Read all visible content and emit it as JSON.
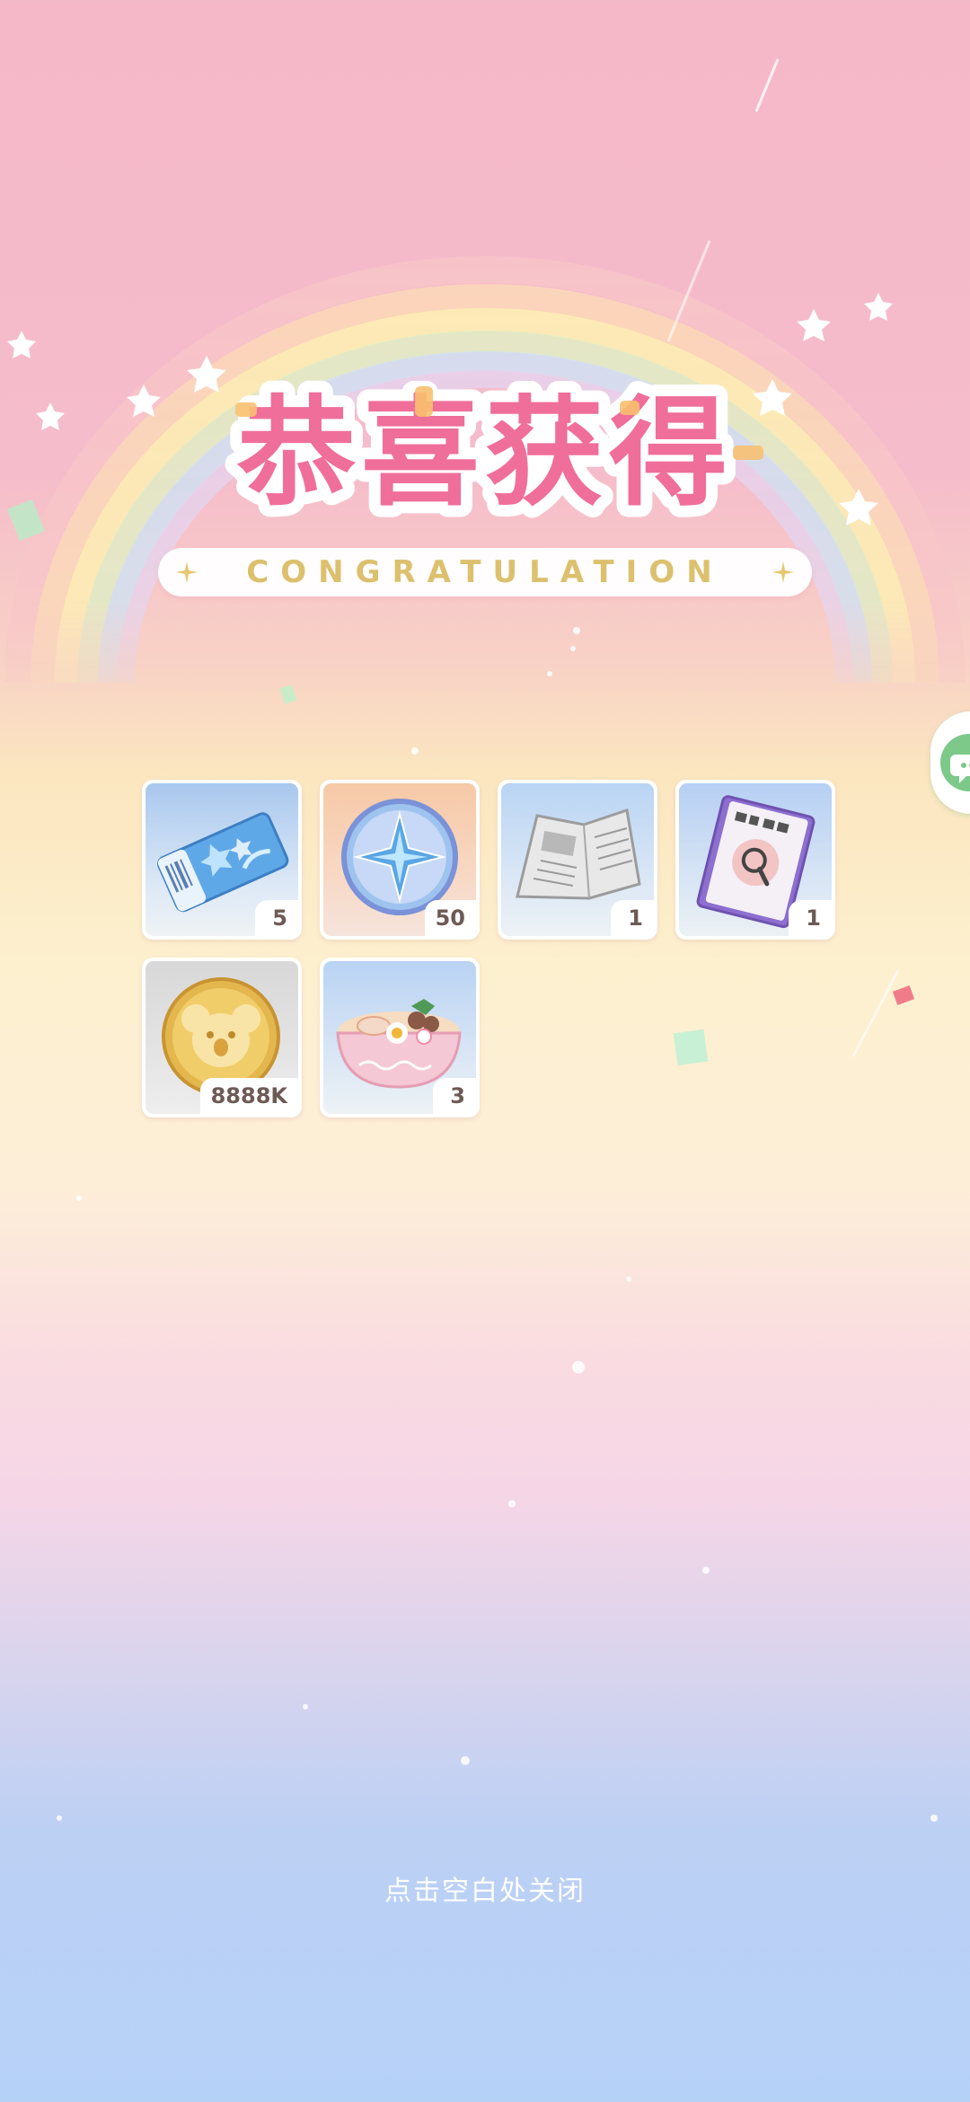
{
  "popup": {
    "title": "恭喜获得",
    "subtitle": "CONGRATULATION",
    "close_hint": "点击空白处关闭"
  },
  "rewards": [
    {
      "icon": "blue-ticket-icon",
      "count": "5"
    },
    {
      "icon": "compass-star-medal-icon",
      "count": "50"
    },
    {
      "icon": "newspaper-icon",
      "count": "1"
    },
    {
      "icon": "magnifier-book-icon",
      "count": "1"
    },
    {
      "icon": "koala-gold-coin-icon",
      "count": "8888K"
    },
    {
      "icon": "ramen-bowl-icon",
      "count": "3"
    }
  ],
  "side_button": {
    "icon": "chat-bubble-icon",
    "color": "#7cc98a"
  },
  "colors": {
    "title_pink": "#f06e9a",
    "subtitle_gold": "#dcc06e",
    "count_text": "#6e5a55"
  }
}
